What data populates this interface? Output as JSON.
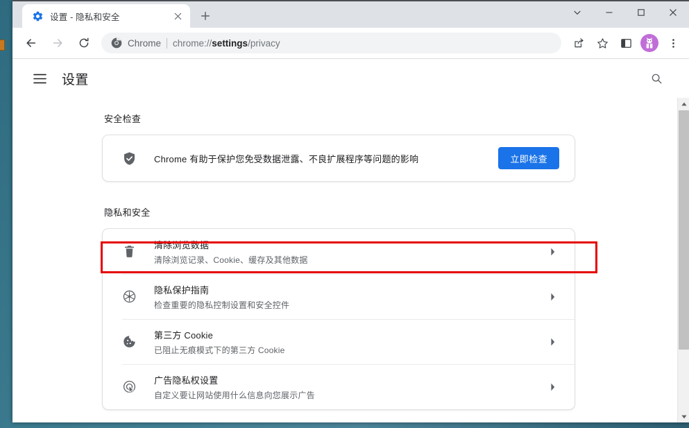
{
  "window": {
    "controls": [
      {
        "name": "chevron-down-icon",
        "label": ""
      },
      {
        "name": "minimize-icon",
        "label": ""
      },
      {
        "name": "maximize-icon",
        "label": ""
      },
      {
        "name": "close-icon",
        "label": ""
      }
    ]
  },
  "tab": {
    "title": "设置 - 隐私和安全",
    "favicon": "gear-icon",
    "close_icon": "close-icon",
    "new_tab_icon": "plus-icon"
  },
  "toolbar": {
    "back_icon": "back-arrow-icon",
    "forward_icon": "forward-arrow-icon",
    "reload_icon": "reload-icon",
    "omnibox": {
      "site_icon": "chrome-logo-icon",
      "chrome_label": "Chrome",
      "url_prefix": "chrome://",
      "url_bold": "settings",
      "url_suffix": "/privacy"
    },
    "share_icon": "share-icon",
    "bookmark_icon": "star-icon",
    "side_panel_icon": "side-panel-icon",
    "avatar_icon": "avatar-icon",
    "menu_icon": "three-dot-menu-icon"
  },
  "settings_header": {
    "menu_icon": "hamburger-menu-icon",
    "title": "设置",
    "search_icon": "search-icon"
  },
  "safety_check": {
    "heading": "安全检查",
    "icon": "shield-check-icon",
    "description": "Chrome 有助于保护您免受数据泄露、不良扩展程序等问题的影响",
    "button_label": "立即检查",
    "button_color": "#1a73e8"
  },
  "privacy": {
    "heading": "隐私和安全",
    "rows": [
      {
        "icon": "trash-icon",
        "title": "清除浏览数据",
        "subtitle": "清除浏览记录、Cookie、缓存及其他数据",
        "arrow": "chevron-right-icon",
        "highlighted": true
      },
      {
        "icon": "privacy-guide-icon",
        "title": "隐私保护指南",
        "subtitle": "检查重要的隐私控制设置和安全控件",
        "arrow": "chevron-right-icon",
        "highlighted": false
      },
      {
        "icon": "cookie-icon",
        "title": "第三方 Cookie",
        "subtitle": "已阻止无痕模式下的第三方 Cookie",
        "arrow": "chevron-right-icon",
        "highlighted": false
      },
      {
        "icon": "ad-privacy-icon",
        "title": "广告隐私权设置",
        "subtitle": "自定义要让网站使用什么信息向您展示广告",
        "arrow": "chevron-right-icon",
        "highlighted": false
      }
    ]
  },
  "highlight": {
    "color": "#e60000"
  },
  "scrollbar": {
    "up_icon": "scroll-up-arrow-icon",
    "down_icon": "scroll-down-arrow-icon"
  }
}
